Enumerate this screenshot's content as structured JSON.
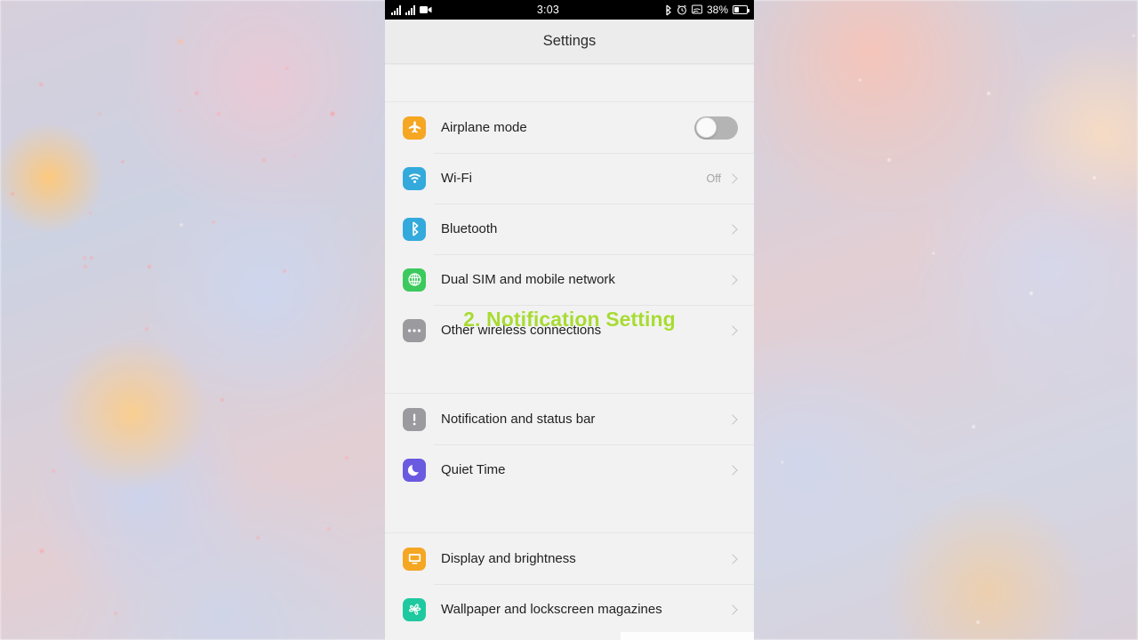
{
  "status_bar": {
    "signal_icon_1": "signal-bars-icon",
    "signal_icon_2": "signal-bars-icon",
    "video_icon": "video-camera-icon",
    "time": "3:03",
    "bluetooth_icon": "bluetooth-icon",
    "alarm_icon": "alarm-clock-icon",
    "cast_icon": "screen-cast-icon",
    "battery_percent": "38%",
    "battery_icon": "battery-icon"
  },
  "header": {
    "title": "Settings"
  },
  "overlay": {
    "caption": "2. Notification Setting",
    "color": "#a8db33"
  },
  "groups": [
    {
      "rows": [
        {
          "label": "Airplane mode",
          "icon": "airplane-icon",
          "icon_color": "#f5a623",
          "control": "toggle",
          "toggle_on": false,
          "value": ""
        },
        {
          "label": "Wi-Fi",
          "icon": "wifi-icon",
          "icon_color": "#34aadc",
          "control": "chevron",
          "value": "Off"
        },
        {
          "label": "Bluetooth",
          "icon": "bluetooth-icon",
          "icon_color": "#34aadc",
          "control": "chevron",
          "value": ""
        },
        {
          "label": "Dual SIM and mobile network",
          "icon": "globe-icon",
          "icon_color": "#3cc95d",
          "control": "chevron",
          "value": ""
        },
        {
          "label": "Other wireless connections",
          "icon": "more-dots-icon",
          "icon_color": "#9a9a9f",
          "control": "chevron",
          "value": ""
        }
      ]
    },
    {
      "rows": [
        {
          "label": "Notification and status bar",
          "icon": "exclamation-icon",
          "icon_color": "#9a9a9f",
          "control": "chevron",
          "value": ""
        },
        {
          "label": "Quiet Time",
          "icon": "moon-icon",
          "icon_color": "#6a5ae0",
          "control": "chevron",
          "value": ""
        }
      ]
    },
    {
      "rows": [
        {
          "label": "Display and brightness",
          "icon": "monitor-icon",
          "icon_color": "#f5a623",
          "control": "chevron",
          "value": ""
        },
        {
          "label": "Wallpaper and lockscreen magazines",
          "icon": "pinwheel-icon",
          "icon_color": "#1fc9a0",
          "control": "chevron",
          "value": ""
        }
      ]
    }
  ]
}
